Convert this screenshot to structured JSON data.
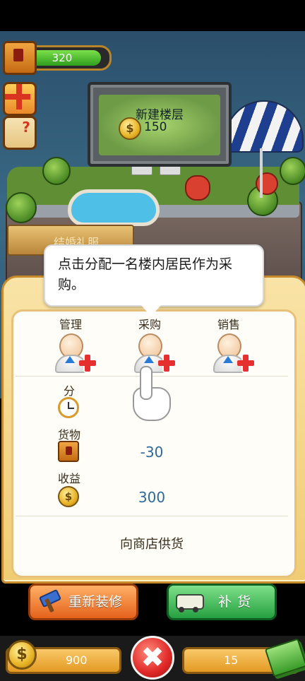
{
  "hud": {
    "boxes": "320",
    "coins": "900",
    "bucks": "15"
  },
  "billboard": {
    "title": "新建楼层",
    "price": "150",
    "coin_symbol": "$"
  },
  "sign_text": "结婚礼服",
  "tooltip": "点击分配一名楼内居民作为采购。",
  "roles": [
    {
      "label": "管理"
    },
    {
      "label": "采购"
    },
    {
      "label": "销售"
    }
  ],
  "stats": {
    "time_label": "分",
    "goods_label": "货物",
    "goods_value": "-30",
    "income_label": "收益",
    "income_value": "300"
  },
  "supply_text": "向商店供货",
  "buttons": {
    "renovate": "重新装修",
    "restock": "补货"
  },
  "close_symbol": "✖",
  "help_symbol": "?"
}
